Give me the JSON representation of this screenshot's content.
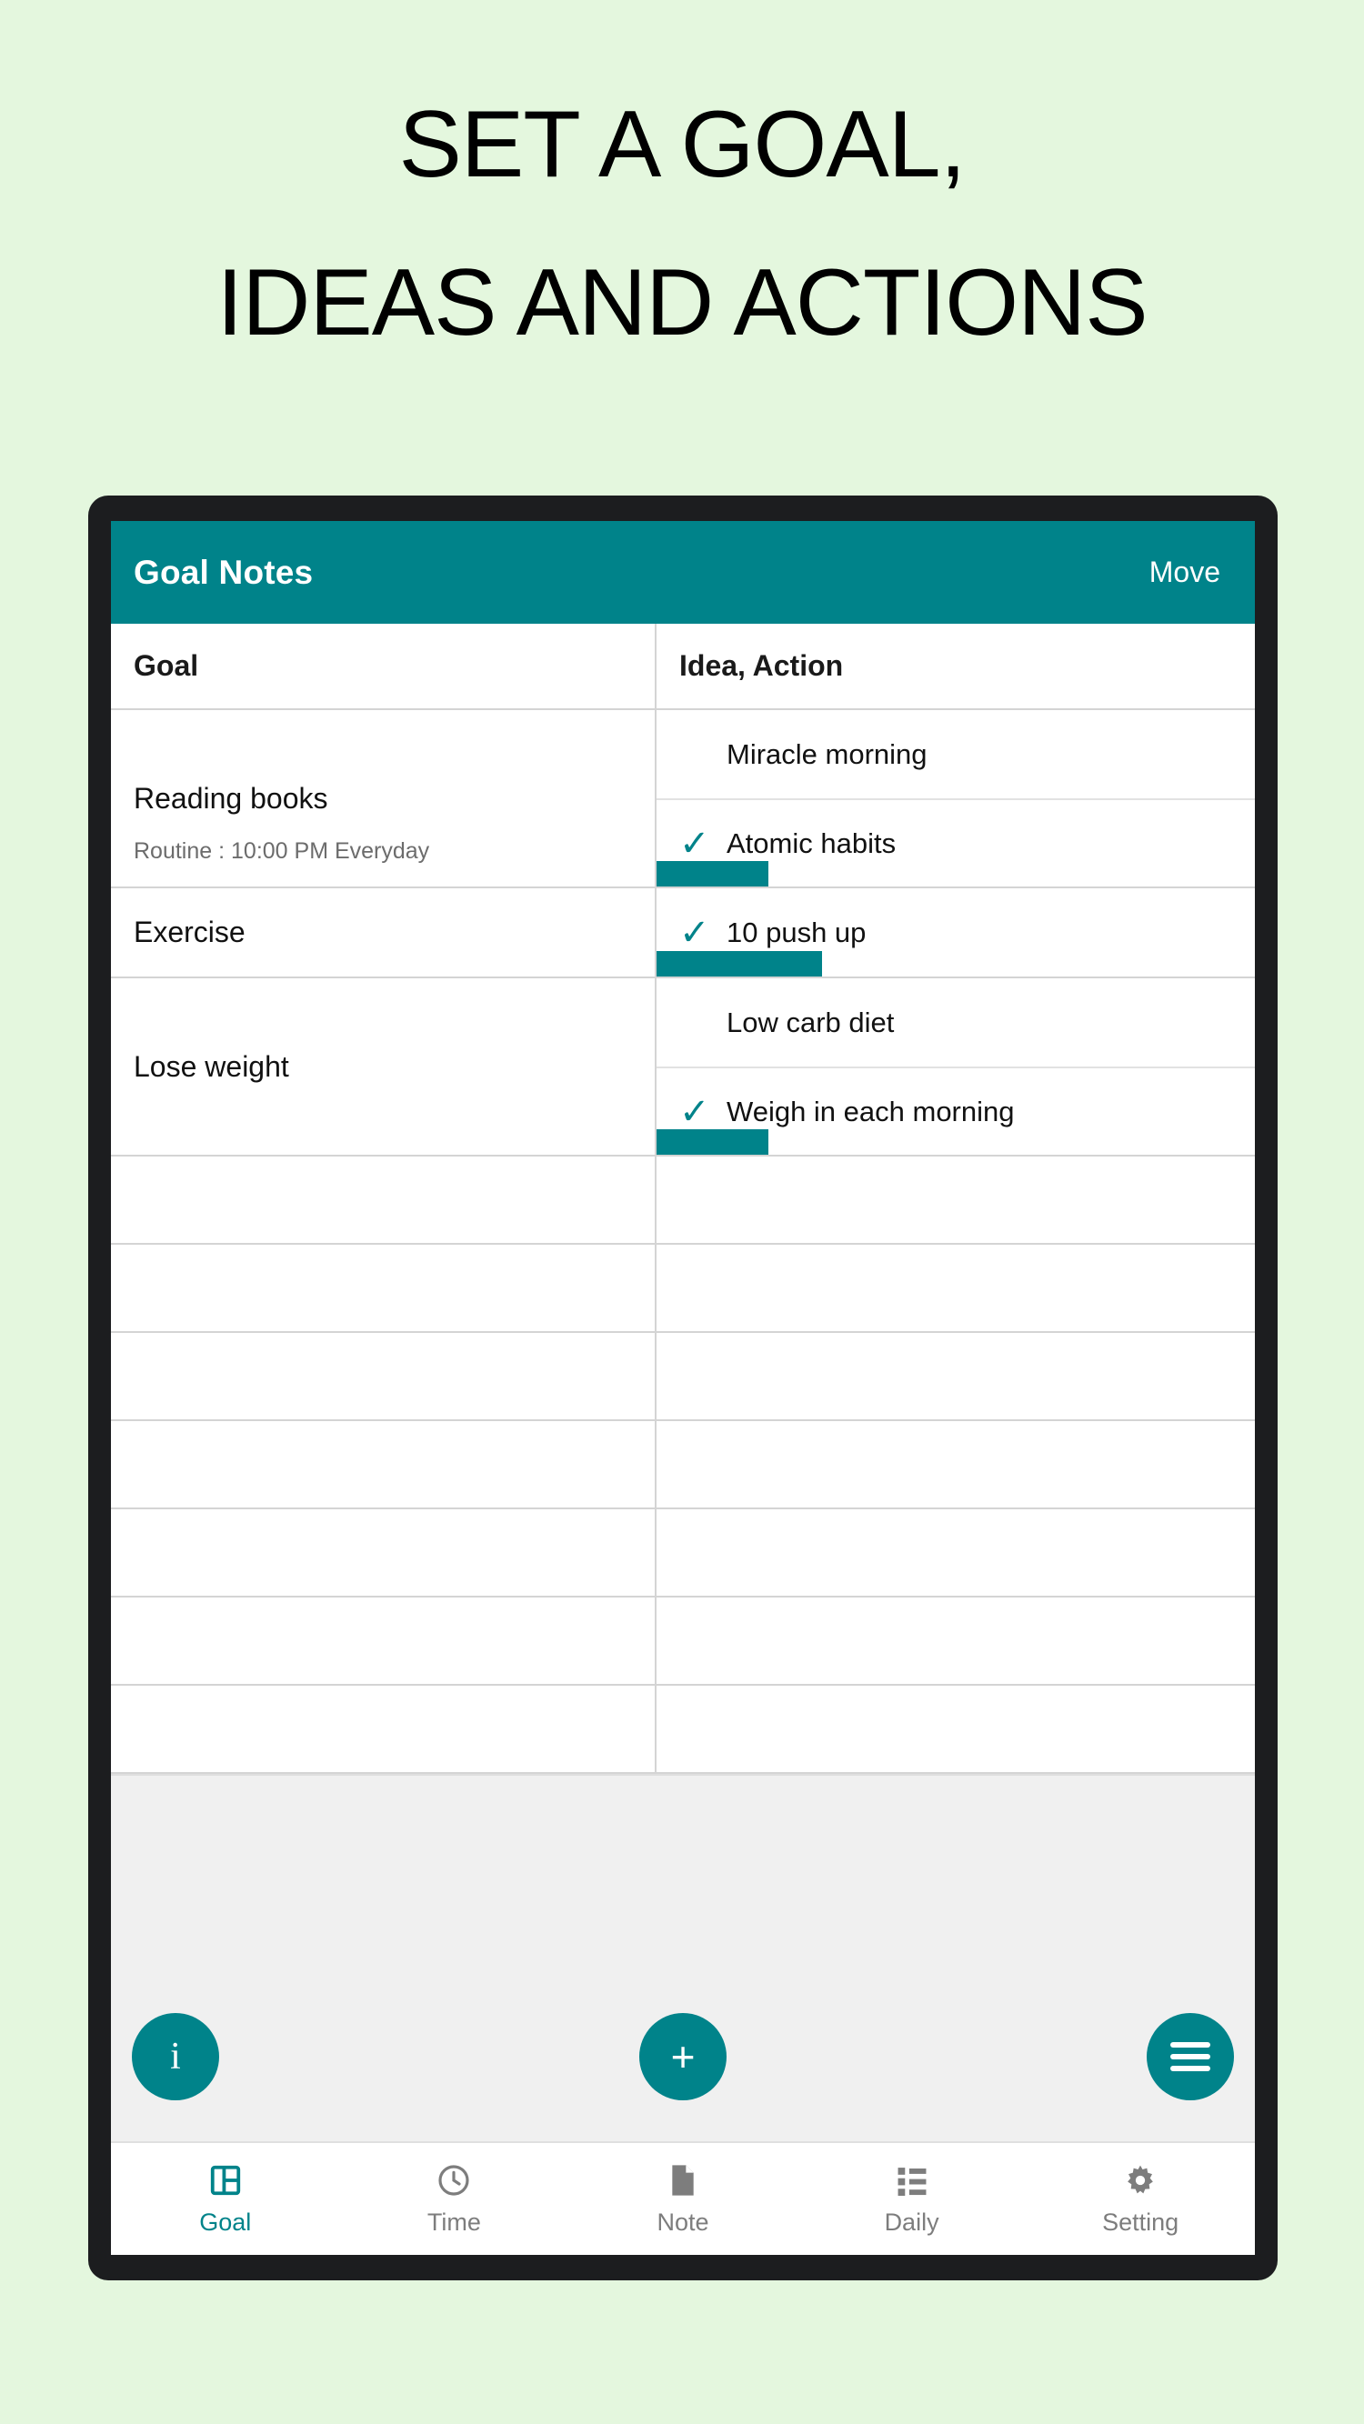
{
  "headline": {
    "line1": "SET A GOAL,",
    "line2": "IDEAS AND ACTIONS"
  },
  "colors": {
    "background": "#e4f7de",
    "accent": "#00838a",
    "frame": "#1c1d1f",
    "fab_area": "#f0f0f0"
  },
  "appbar": {
    "title": "Goal Notes",
    "action_label": "Move"
  },
  "table": {
    "headers": [
      "Goal",
      "Idea, Action"
    ],
    "rows": [
      {
        "goal": "Reading books",
        "routine": "Routine : 10:00 PM Everyday",
        "items": [
          {
            "text": "Miracle morning",
            "checked": false,
            "progress": 0
          },
          {
            "text": "Atomic habits",
            "checked": true,
            "progress": 123
          }
        ]
      },
      {
        "goal": "Exercise",
        "routine": "",
        "items": [
          {
            "text": "10 push up",
            "checked": true,
            "progress": 182
          }
        ]
      },
      {
        "goal": "Lose weight",
        "routine": "",
        "items": [
          {
            "text": "Low carb diet",
            "checked": false,
            "progress": 0
          },
          {
            "text": "Weigh in each morning",
            "checked": true,
            "progress": 123
          }
        ]
      }
    ],
    "empty_row_count": 7
  },
  "fabs": [
    {
      "name": "info",
      "glyph": "i"
    },
    {
      "name": "add",
      "glyph": "+"
    },
    {
      "name": "menu",
      "glyph": "≡"
    }
  ],
  "bottomnav": {
    "items": [
      {
        "label": "Goal",
        "icon": "dashboard-icon",
        "active": true
      },
      {
        "label": "Time",
        "icon": "clock-icon",
        "active": false
      },
      {
        "label": "Note",
        "icon": "document-icon",
        "active": false
      },
      {
        "label": "Daily",
        "icon": "list-icon",
        "active": false
      },
      {
        "label": "Setting",
        "icon": "gear-icon",
        "active": false
      }
    ]
  },
  "checkmark_glyph": "✓"
}
